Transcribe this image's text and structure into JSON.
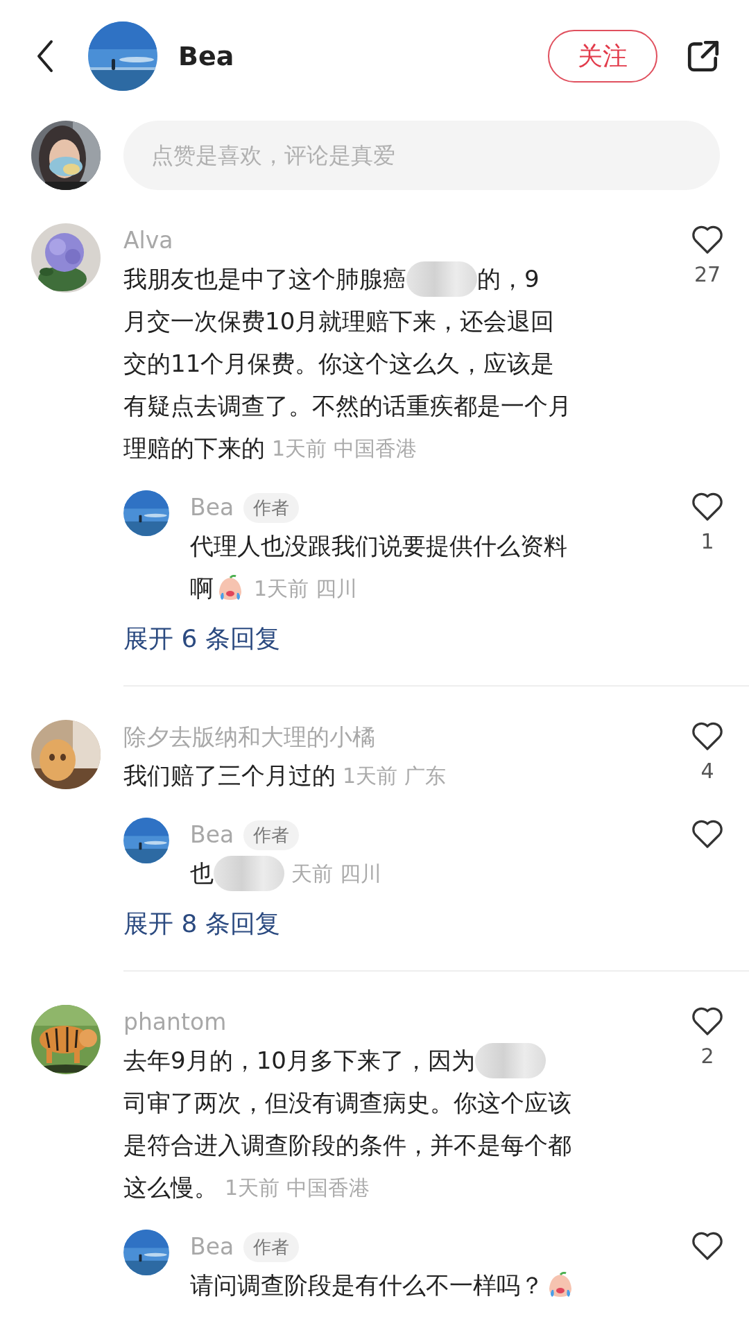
{
  "header": {
    "name": "Bea",
    "follow_button": "关注"
  },
  "comment_input": {
    "placeholder": "点赞是喜欢，评论是真爱"
  },
  "comments": [
    {
      "user": "Alva",
      "lines": [
        [
          {
            "kind": "text",
            "text": "我朋友也是中了这个肺腺癌"
          },
          {
            "kind": "blur"
          },
          {
            "kind": "text",
            "text": "的，9"
          }
        ],
        [
          {
            "kind": "text",
            "text": "月交一次保费10月就理赔下来，还会退回"
          }
        ],
        [
          {
            "kind": "text",
            "text": "交的11个月保费。你这个这么久，应该是"
          }
        ],
        [
          {
            "kind": "text",
            "text": "有疑点去调查了。不然的话重疾都是一个月"
          }
        ],
        [
          {
            "kind": "text",
            "text": "理赔的下来的"
          }
        ]
      ],
      "time": "1天前",
      "location": "中国香港",
      "likes": "27",
      "replies": [
        {
          "user": "Bea",
          "tag": "作者",
          "lines": [
            [
              {
                "kind": "text",
                "text": "代理人也没跟我们说要提供什么资料"
              }
            ],
            [
              {
                "kind": "text",
                "text": "啊"
              },
              {
                "kind": "emoji"
              }
            ]
          ],
          "time": "1天前",
          "location": "四川",
          "likes": "1"
        }
      ],
      "expand_link": "展开 6 条回复"
    },
    {
      "user": "除夕去版纳和大理的小橘",
      "lines": [
        [
          {
            "kind": "text",
            "text": "我们赔了三个月过的"
          }
        ]
      ],
      "time": "1天前",
      "location": "广东",
      "likes": "4",
      "replies": [
        {
          "user": "Bea",
          "tag": "作者",
          "lines": [
            [
              {
                "kind": "text",
                "text": "也"
              },
              {
                "kind": "blur"
              }
            ]
          ],
          "time": "天前",
          "location": "四川"
        }
      ],
      "expand_link": "展开 8 条回复"
    },
    {
      "user": "phantom",
      "lines": [
        [
          {
            "kind": "text",
            "text": "去年9月的，10月多下来了，因为"
          },
          {
            "kind": "blur"
          }
        ],
        [
          {
            "kind": "text",
            "text": "司审了两次，但没有调查病史。你这个应该"
          }
        ],
        [
          {
            "kind": "text",
            "text": "是符合进入调查阶段的条件，并不是每个都"
          }
        ],
        [
          {
            "kind": "text",
            "text": "这么慢。"
          }
        ]
      ],
      "time": "1天前",
      "location": "中国香港",
      "likes": "2",
      "replies": [
        {
          "user": "Bea",
          "tag": "作者",
          "lines": [
            [
              {
                "kind": "text",
                "text": "请问调查阶段是有什么不一样吗？"
              },
              {
                "kind": "emoji"
              }
            ]
          ]
        }
      ]
    }
  ]
}
